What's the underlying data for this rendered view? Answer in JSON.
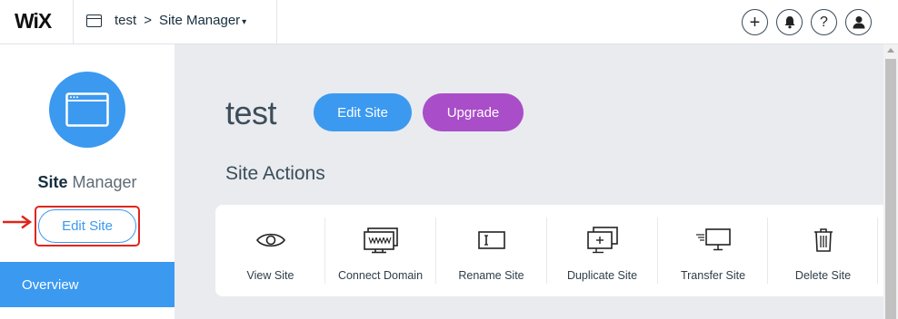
{
  "topbar": {
    "logo": "WiX",
    "breadcrumb_site": "test",
    "breadcrumb_sep": ">",
    "breadcrumb_current": "Site Manager",
    "caret": "▾",
    "add_icon": "+",
    "help_icon": "?"
  },
  "sidebar": {
    "title_bold": "Site",
    "title_light": "Manager",
    "edit_button": "Edit Site",
    "overview": "Overview"
  },
  "main": {
    "site_name": "test",
    "edit_button": "Edit Site",
    "upgrade_button": "Upgrade",
    "section_title": "Site Actions",
    "actions": [
      {
        "label": "View Site",
        "icon": "eye-icon"
      },
      {
        "label": "Connect Domain",
        "icon": "www-monitor-icon"
      },
      {
        "label": "Rename Site",
        "icon": "rename-icon"
      },
      {
        "label": "Duplicate Site",
        "icon": "duplicate-icon"
      },
      {
        "label": "Transfer Site",
        "icon": "transfer-icon"
      },
      {
        "label": "Delete Site",
        "icon": "trash-icon"
      }
    ]
  },
  "colors": {
    "accent": "#3b99f0",
    "upgrade": "#aa4dc8",
    "highlight": "#e0251b",
    "background": "#e9ebef"
  }
}
